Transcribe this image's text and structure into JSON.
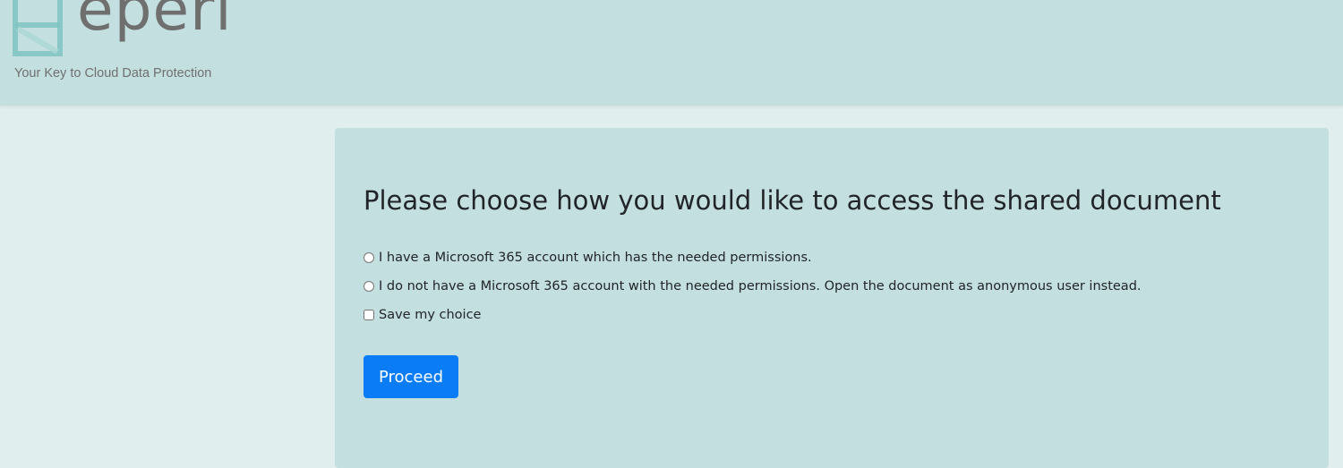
{
  "header": {
    "logo_text": "eperi",
    "tagline": "Your Key to Cloud Data Protection"
  },
  "form": {
    "title": "Please choose how you would like to access the shared document",
    "option_account": "I have a Microsoft 365 account which has the needed permissions.",
    "option_anonymous": "I do not have a Microsoft 365 account with the needed permissions. Open the document as anonymous user instead.",
    "save_choice": "Save my choice",
    "proceed_label": "Proceed"
  },
  "colors": {
    "header_bg": "#c4dfdf",
    "page_bg": "#e0efee",
    "card_bg": "#c4dfdf",
    "button_bg": "#0a7cf6",
    "logo_teal": "#7fc4c2",
    "logo_gray": "#6f6f6f"
  },
  "icons": {
    "logo_mark": "eperi-logo-icon"
  }
}
